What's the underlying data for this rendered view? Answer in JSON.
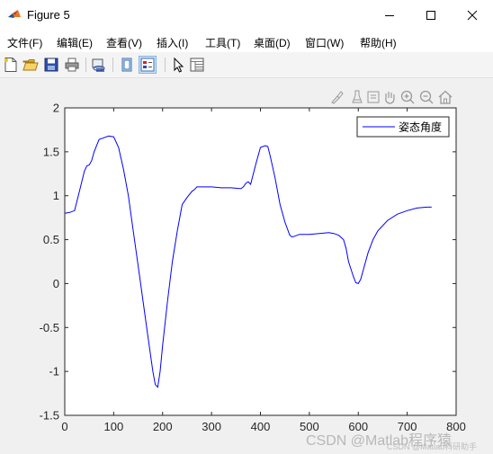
{
  "window": {
    "title": "Figure 5"
  },
  "menu": [
    "文件(F)",
    "编辑(E)",
    "查看(V)",
    "插入(I)",
    "工具(T)",
    "桌面(D)",
    "窗口(W)",
    "帮助(H)"
  ],
  "toolbar": {
    "icons": [
      "new-figure-icon",
      "open-file-icon",
      "save-icon",
      "print-icon",
      "link-plot-icon",
      "hide-plot-tools-icon",
      "show-plot-tools-icon",
      "edit-plot-icon",
      "property-inspector-icon"
    ],
    "active": "show-plot-tools-icon"
  },
  "axes_toolbar": {
    "icons": [
      "brush-icon",
      "data-tips-icon",
      "rotate-icon",
      "pan-icon",
      "zoom-in-icon",
      "zoom-out-icon",
      "home-icon"
    ]
  },
  "colors": {
    "line": "#0000ff",
    "axes_bg": "#ffffff",
    "figure_bg": "#f0f0f0"
  },
  "watermark": {
    "main": "CSDN @Matlab程序猿",
    "sub": "CSDN @Matlab科研助手"
  },
  "chart_data": {
    "type": "line",
    "title": "",
    "xlabel": "",
    "ylabel": "",
    "xlim": [
      0,
      800
    ],
    "ylim": [
      -1.5,
      2
    ],
    "xticks": [
      0,
      100,
      200,
      300,
      400,
      500,
      600,
      700,
      800
    ],
    "xtick_labels": [
      "0",
      "100",
      "200",
      "300",
      "400",
      "500",
      "600",
      "700",
      "800"
    ],
    "yticks": [
      -1.5,
      -1,
      -0.5,
      0,
      0.5,
      1,
      1.5,
      2
    ],
    "ytick_labels": [
      "-1.5",
      "-1",
      "-0.5",
      "0",
      "0.5",
      "1",
      "1.5",
      "2"
    ],
    "grid": false,
    "legend": {
      "location": "top-right",
      "entries": [
        "姿态角度"
      ]
    },
    "series": [
      {
        "name": "姿态角度",
        "color": "#0000ff",
        "x": [
          0,
          10,
          20,
          30,
          40,
          45,
          50,
          55,
          60,
          70,
          80,
          90,
          100,
          110,
          120,
          130,
          140,
          150,
          160,
          170,
          180,
          185,
          190,
          195,
          200,
          210,
          220,
          230,
          240,
          250,
          260,
          265,
          270,
          280,
          290,
          300,
          320,
          340,
          360,
          365,
          370,
          375,
          380,
          390,
          400,
          410,
          415,
          420,
          430,
          440,
          450,
          460,
          465,
          470,
          480,
          500,
          520,
          540,
          550,
          560,
          570,
          575,
          580,
          590,
          595,
          600,
          605,
          610,
          620,
          630,
          640,
          660,
          680,
          700,
          720,
          740,
          750
        ],
        "y": [
          0.8,
          0.81,
          0.83,
          1.05,
          1.28,
          1.34,
          1.35,
          1.4,
          1.5,
          1.64,
          1.66,
          1.68,
          1.67,
          1.55,
          1.3,
          1.0,
          0.6,
          0.2,
          -0.2,
          -0.6,
          -1.0,
          -1.15,
          -1.18,
          -1.0,
          -0.7,
          -0.2,
          0.25,
          0.6,
          0.9,
          0.98,
          1.05,
          1.07,
          1.1,
          1.1,
          1.1,
          1.1,
          1.09,
          1.09,
          1.08,
          1.1,
          1.14,
          1.16,
          1.13,
          1.35,
          1.55,
          1.57,
          1.56,
          1.45,
          1.2,
          0.9,
          0.7,
          0.55,
          0.53,
          0.54,
          0.56,
          0.56,
          0.57,
          0.58,
          0.57,
          0.55,
          0.5,
          0.4,
          0.25,
          0.08,
          0.01,
          0.0,
          0.05,
          0.15,
          0.35,
          0.5,
          0.6,
          0.72,
          0.79,
          0.83,
          0.86,
          0.87,
          0.87
        ]
      }
    ]
  }
}
